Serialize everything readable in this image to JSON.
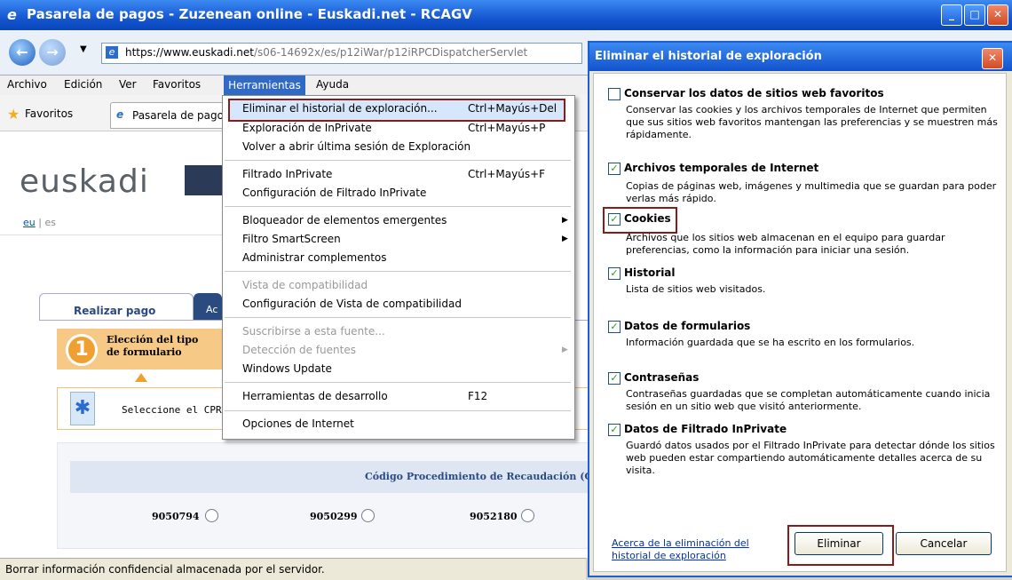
{
  "window": {
    "title": "Pasarela de pagos - Zuzenean online - Euskadi.net - RCAGV",
    "address_domain": "https://www.euskadi.net",
    "address_path": "/s06-14692x/es/p12iWar/p12iRPCDispatcherServlet"
  },
  "menubar": [
    "Archivo",
    "Edición",
    "Ver",
    "Favoritos",
    "Herramientas",
    "Ayuda"
  ],
  "favbar": {
    "favoritos": "Favoritos",
    "tab_title": "Pasarela de pago"
  },
  "page": {
    "logo": "euskadi",
    "lang_eu": "eu",
    "lang_sep": "|",
    "lang_es": "es",
    "tab_realizar": "Realizar pago",
    "tab_ac": "Ac",
    "step_number": "1",
    "step_line1": "Elección del tipo",
    "step_line2": "de formulario",
    "select_text": "Seleccione el CPR",
    "codigo_header": "Código Procedimiento de Recaudación (C",
    "codes": [
      "9050794",
      "9050299",
      "9052180"
    ]
  },
  "tools_menu": {
    "items": [
      {
        "label": "Eliminar el historial de exploración...",
        "shortcut": "Ctrl+Mayús+Del"
      },
      {
        "label": "Exploración de InPrivate",
        "shortcut": "Ctrl+Mayús+P"
      },
      {
        "label": "Volver a abrir última sesión de Exploración",
        "shortcut": ""
      },
      {
        "label": "Filtrado InPrivate",
        "shortcut": "Ctrl+Mayús+F"
      },
      {
        "label": "Configuración de Filtrado InPrivate",
        "shortcut": ""
      },
      {
        "label": "Bloqueador de elementos emergentes",
        "shortcut": ""
      },
      {
        "label": "Filtro SmartScreen",
        "shortcut": ""
      },
      {
        "label": "Administrar complementos",
        "shortcut": ""
      },
      {
        "label": "Vista de compatibilidad",
        "shortcut": ""
      },
      {
        "label": "Configuración de Vista de compatibilidad",
        "shortcut": ""
      },
      {
        "label": "Suscribirse a esta fuente...",
        "shortcut": ""
      },
      {
        "label": "Detección de fuentes",
        "shortcut": ""
      },
      {
        "label": "Windows Update",
        "shortcut": ""
      },
      {
        "label": "Herramientas de desarrollo",
        "shortcut": "F12"
      },
      {
        "label": "Opciones de Internet",
        "shortcut": ""
      }
    ]
  },
  "dialog": {
    "title": "Eliminar el historial de exploración",
    "options": [
      {
        "label": "Conservar los datos de sitios web favoritos",
        "checked": false,
        "desc": "Conservar las cookies y los archivos temporales de Internet que permiten que sus sitios web favoritos mantengan las preferencias y se muestren más rápidamente."
      },
      {
        "label": "Archivos temporales de Internet",
        "checked": true,
        "desc": "Copias de páginas web, imágenes y multimedia que se guardan para poder verlas más rápido."
      },
      {
        "label": "Cookies",
        "checked": true,
        "desc": "Archivos que los sitios web almacenan en el equipo para guardar preferencias, como la información para iniciar una sesión."
      },
      {
        "label": "Historial",
        "checked": true,
        "desc": "Lista de sitios web visitados."
      },
      {
        "label": "Datos de formularios",
        "checked": true,
        "desc": "Información guardada que se ha escrito en los formularios."
      },
      {
        "label": "Contraseñas",
        "checked": true,
        "desc": "Contraseñas guardadas que se completan automáticamente cuando inicia sesión en un sitio web que visitó anteriormente."
      },
      {
        "label": "Datos de Filtrado InPrivate",
        "checked": true,
        "desc": "Guardó datos usados por el Filtrado InPrivate para detectar dónde los sitios web pueden estar compartiendo automáticamente detalles acerca de su visita."
      }
    ],
    "about_link": "Acerca de la eliminación del historial de exploración",
    "btn_delete": "Eliminar",
    "btn_cancel": "Cancelar"
  },
  "status": "Borrar información confidencial almacenada por el servidor."
}
